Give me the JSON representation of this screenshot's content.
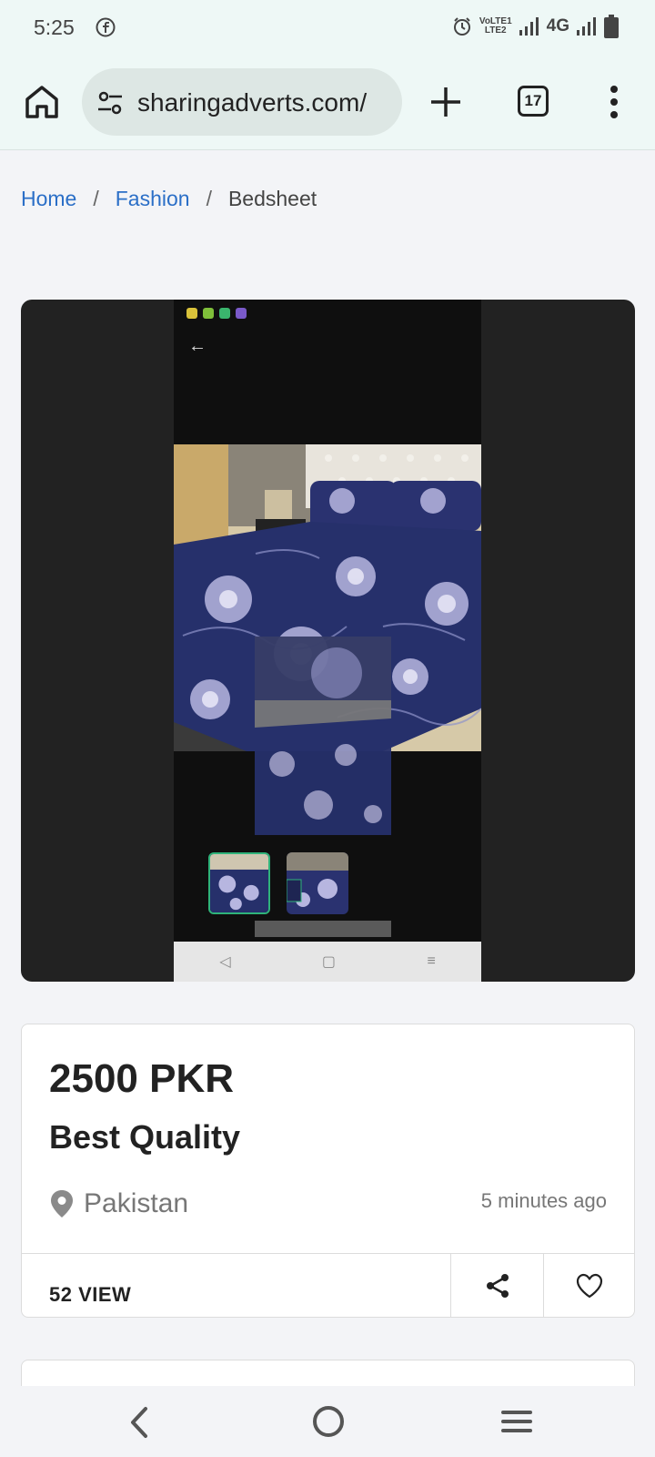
{
  "status_bar": {
    "time": "5:25",
    "network": "4G",
    "lte_label_top": "VoLTE1",
    "lte_label_bottom": "LTE2",
    "icons": [
      "facebook-icon",
      "alarm-icon",
      "signal-icon",
      "battery-icon"
    ]
  },
  "browser": {
    "url": "sharingadverts.com/",
    "tab_count": "17"
  },
  "breadcrumb": {
    "items": [
      "Home",
      "Fashion",
      "Bedsheet"
    ],
    "separator": "/"
  },
  "listing": {
    "price": "2500 PKR",
    "title": "Best Quality",
    "location": "Pakistan",
    "posted": "5 minutes ago",
    "views": "52 VIEW"
  },
  "colors": {
    "link": "#2b6fc7",
    "toolbar_bg": "#eef8f6",
    "bedsheet_navy": "#26306b",
    "thumb_active": "#2fb37a"
  }
}
